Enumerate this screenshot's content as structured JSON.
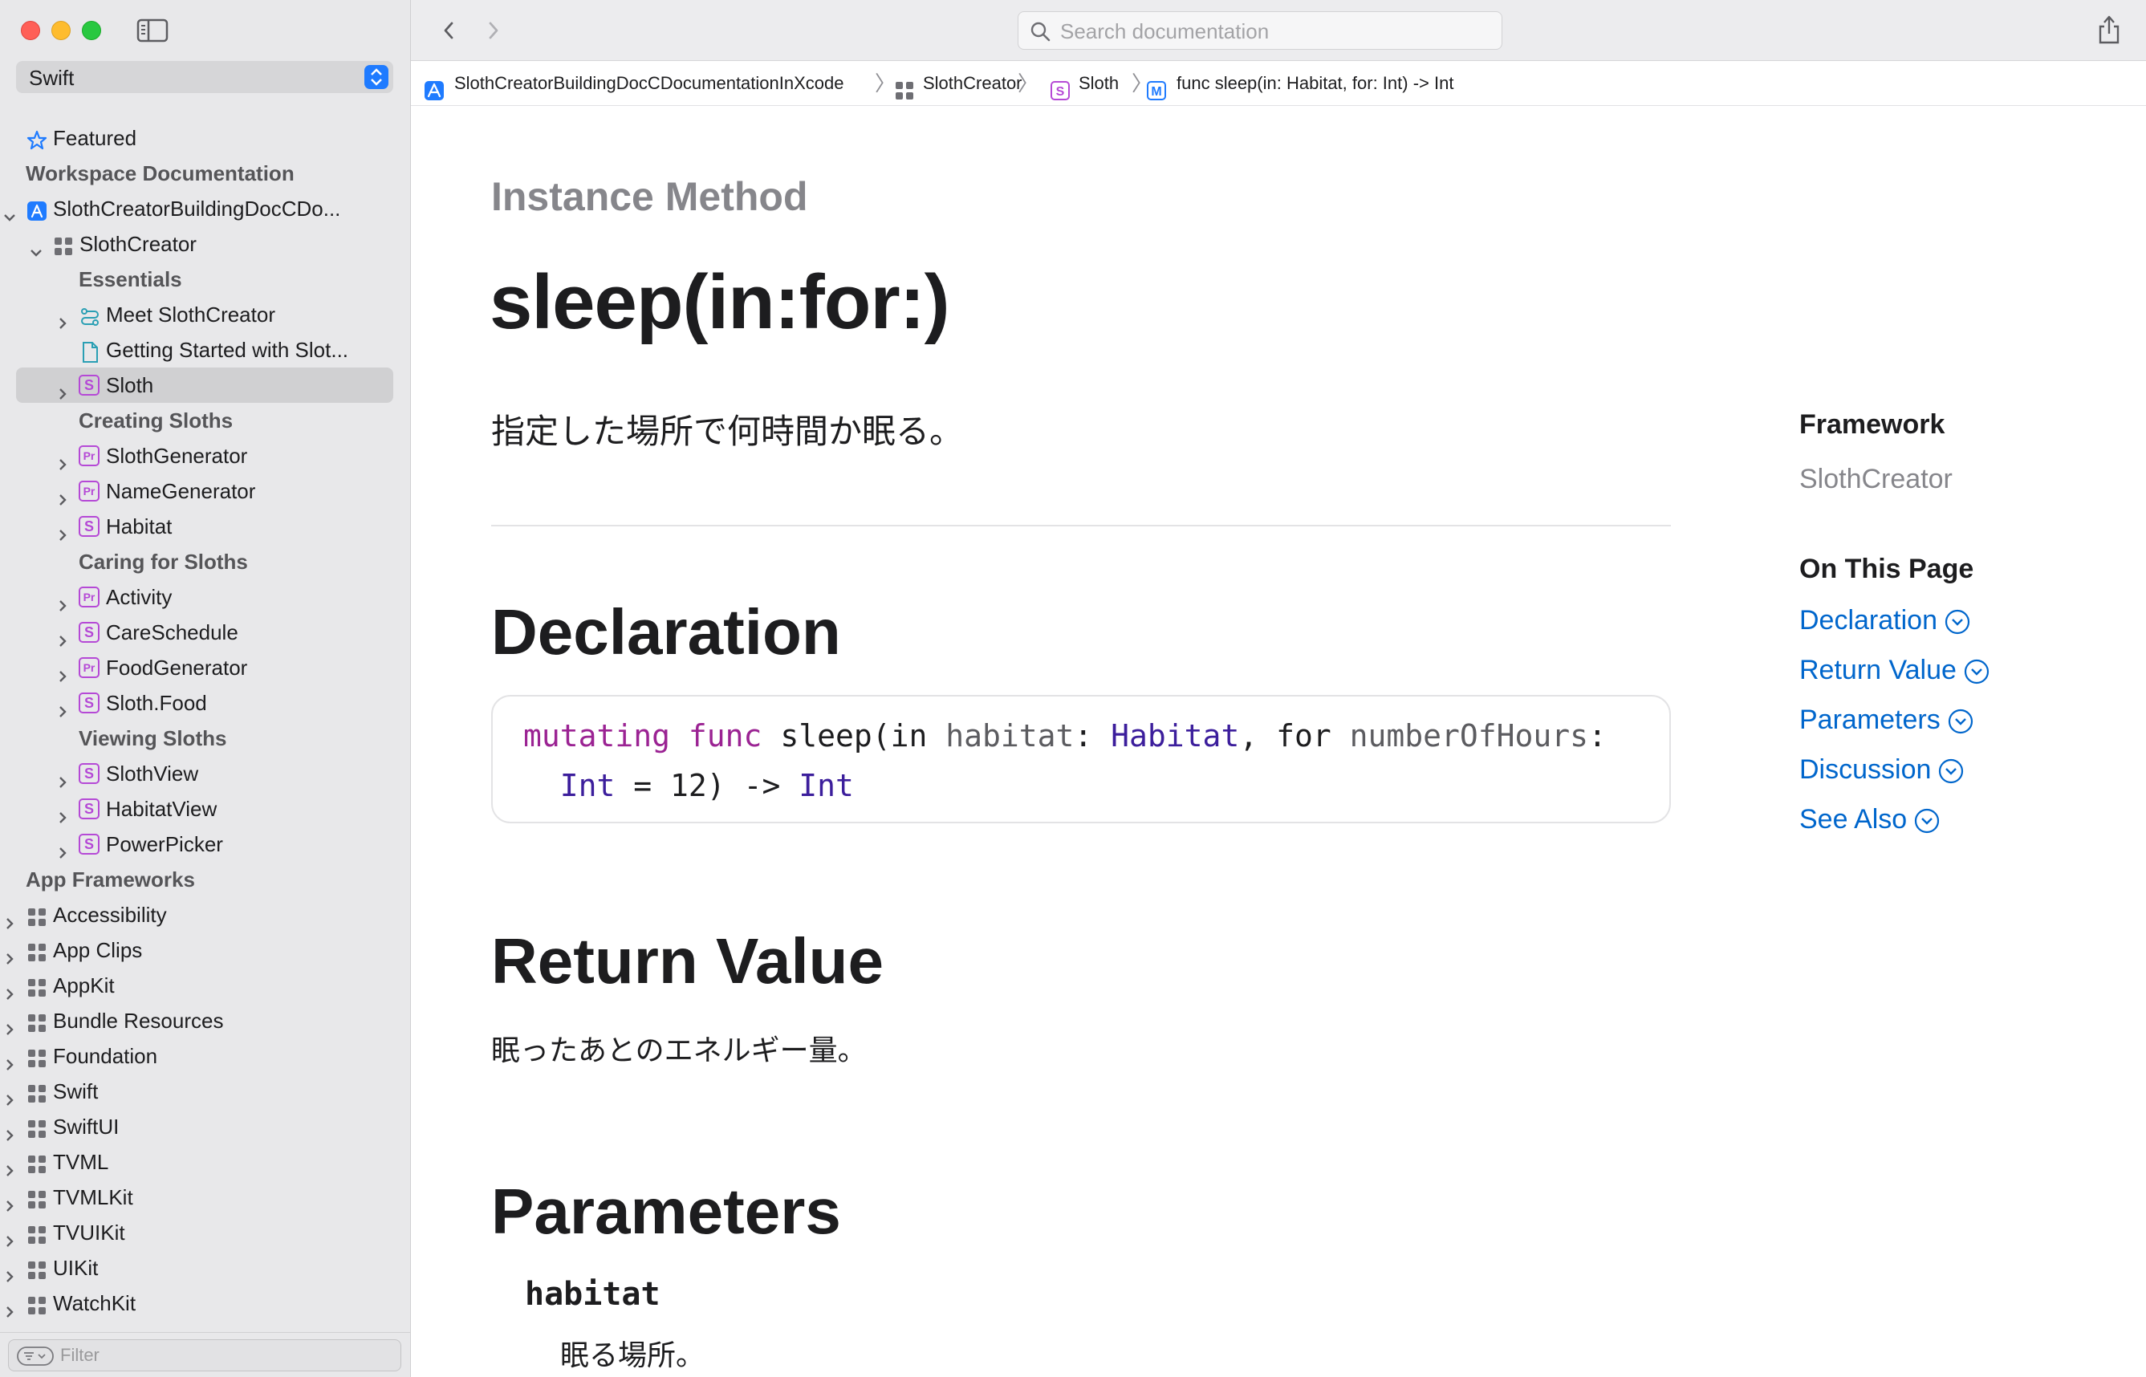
{
  "sidebar": {
    "language": "Swift",
    "filter_placeholder": "Filter",
    "rows": [
      {
        "label": "Featured",
        "level": 0,
        "kind": "star",
        "disclosure": false,
        "header": false,
        "selected": false
      },
      {
        "label": "Workspace Documentation",
        "level": 0,
        "kind": "none",
        "disclosure": false,
        "header": true,
        "selected": false
      },
      {
        "label": "SlothCreatorBuildingDocCDo...",
        "level": 0,
        "kind": "app",
        "disclosure": "open",
        "header": false,
        "selected": false
      },
      {
        "label": "SlothCreator",
        "level": 1,
        "kind": "framework",
        "disclosure": "open",
        "header": false,
        "selected": false
      },
      {
        "label": "Essentials",
        "level": 2,
        "kind": "none",
        "disclosure": false,
        "header": true,
        "selected": false
      },
      {
        "label": "Meet SlothCreator",
        "level": 2,
        "kind": "tutorial",
        "disclosure": "closed",
        "header": false,
        "selected": false
      },
      {
        "label": "Getting Started with Slot...",
        "level": 2,
        "kind": "article",
        "disclosure": false,
        "header": false,
        "selected": false
      },
      {
        "label": "Sloth",
        "level": 2,
        "kind": "S",
        "disclosure": "closed",
        "header": false,
        "selected": true
      },
      {
        "label": "Creating Sloths",
        "level": 2,
        "kind": "none",
        "disclosure": false,
        "header": true,
        "selected": false
      },
      {
        "label": "SlothGenerator",
        "level": 2,
        "kind": "Pr",
        "disclosure": "closed",
        "header": false,
        "selected": false
      },
      {
        "label": "NameGenerator",
        "level": 2,
        "kind": "Pr",
        "disclosure": "closed",
        "header": false,
        "selected": false
      },
      {
        "label": "Habitat",
        "level": 2,
        "kind": "S",
        "disclosure": "closed",
        "header": false,
        "selected": false
      },
      {
        "label": "Caring for Sloths",
        "level": 2,
        "kind": "none",
        "disclosure": false,
        "header": true,
        "selected": false
      },
      {
        "label": "Activity",
        "level": 2,
        "kind": "Pr",
        "disclosure": "closed",
        "header": false,
        "selected": false
      },
      {
        "label": "CareSchedule",
        "level": 2,
        "kind": "S",
        "disclosure": "closed",
        "header": false,
        "selected": false
      },
      {
        "label": "FoodGenerator",
        "level": 2,
        "kind": "Pr",
        "disclosure": "closed",
        "header": false,
        "selected": false
      },
      {
        "label": "Sloth.Food",
        "level": 2,
        "kind": "S",
        "disclosure": "closed",
        "header": false,
        "selected": false
      },
      {
        "label": "Viewing Sloths",
        "level": 2,
        "kind": "none",
        "disclosure": false,
        "header": true,
        "selected": false
      },
      {
        "label": "SlothView",
        "level": 2,
        "kind": "S",
        "disclosure": "closed",
        "header": false,
        "selected": false
      },
      {
        "label": "HabitatView",
        "level": 2,
        "kind": "S",
        "disclosure": "closed",
        "header": false,
        "selected": false
      },
      {
        "label": "PowerPicker",
        "level": 2,
        "kind": "S",
        "disclosure": "closed",
        "header": false,
        "selected": false
      },
      {
        "label": "App Frameworks",
        "level": 0,
        "kind": "none",
        "disclosure": false,
        "header": true,
        "selected": false
      },
      {
        "label": "Accessibility",
        "level": 0,
        "kind": "framework",
        "disclosure": "closed",
        "header": false,
        "selected": false
      },
      {
        "label": "App Clips",
        "level": 0,
        "kind": "framework",
        "disclosure": "closed",
        "header": false,
        "selected": false
      },
      {
        "label": "AppKit",
        "level": 0,
        "kind": "framework",
        "disclosure": "closed",
        "header": false,
        "selected": false
      },
      {
        "label": "Bundle Resources",
        "level": 0,
        "kind": "framework",
        "disclosure": "closed",
        "header": false,
        "selected": false
      },
      {
        "label": "Foundation",
        "level": 0,
        "kind": "framework",
        "disclosure": "closed",
        "header": false,
        "selected": false
      },
      {
        "label": "Swift",
        "level": 0,
        "kind": "framework",
        "disclosure": "closed",
        "header": false,
        "selected": false
      },
      {
        "label": "SwiftUI",
        "level": 0,
        "kind": "framework",
        "disclosure": "closed",
        "header": false,
        "selected": false
      },
      {
        "label": "TVML",
        "level": 0,
        "kind": "framework",
        "disclosure": "closed",
        "header": false,
        "selected": false
      },
      {
        "label": "TVMLKit",
        "level": 0,
        "kind": "framework",
        "disclosure": "closed",
        "header": false,
        "selected": false
      },
      {
        "label": "TVUIKit",
        "level": 0,
        "kind": "framework",
        "disclosure": "closed",
        "header": false,
        "selected": false
      },
      {
        "label": "UIKit",
        "level": 0,
        "kind": "framework",
        "disclosure": "closed",
        "header": false,
        "selected": false
      },
      {
        "label": "WatchKit",
        "level": 0,
        "kind": "framework",
        "disclosure": "closed",
        "header": false,
        "selected": false
      }
    ]
  },
  "toolbar": {
    "search_placeholder": "Search documentation"
  },
  "breadcrumb": {
    "items": [
      {
        "label": "SlothCreatorBuildingDocCDocumentationInXcode",
        "icon": "app-icon"
      },
      {
        "label": "SlothCreator",
        "icon": "framework-icon"
      },
      {
        "label": "Sloth",
        "icon": "structure-icon"
      },
      {
        "label": "func sleep(in: Habitat, for: Int) -> Int",
        "icon": "method-icon"
      }
    ]
  },
  "page": {
    "kicker": "Instance Method",
    "title": "sleep(in:for:)",
    "abstract": "指定した場所で何時間か眠る。",
    "declaration_heading": "Declaration",
    "declaration": {
      "kw1": "mutating",
      "kw2": "func",
      "name": "sleep(in",
      "p1": "habitat",
      "t1": "Habitat",
      "for": "for",
      "p2": "numberOfHours",
      "t2": "Int",
      "default": "= 12) ->",
      "ret": "Int"
    },
    "return_heading": "Return Value",
    "return_text": "眠ったあとのエネルギー量。",
    "parameters_heading": "Parameters",
    "param_name": "habitat",
    "param_desc": "眠る場所。"
  },
  "aside": {
    "framework_label": "Framework",
    "framework_value": "SlothCreator",
    "on_this_page_label": "On This Page",
    "links": [
      "Declaration",
      "Return Value",
      "Parameters",
      "Discussion",
      "See Also"
    ]
  },
  "colors": {
    "link": "#0066cc",
    "keyword": "#9b2393",
    "type": "#3c1e9c",
    "symbol_badge": "#b549d6",
    "accent": "#1f7bff"
  }
}
